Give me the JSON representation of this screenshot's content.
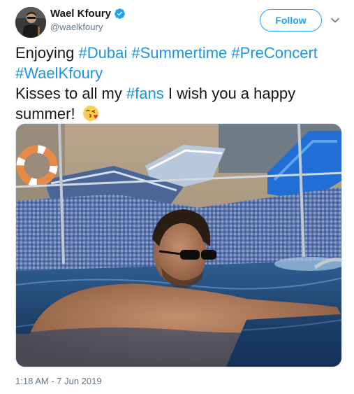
{
  "author": {
    "display_name": "Wael Kfoury",
    "handle": "@waelkfoury",
    "verified": true
  },
  "follow_button": {
    "label": "Follow"
  },
  "tweet": {
    "line1_prefix": "Enjoying ",
    "hashtag_dubai": "#Dubai",
    "hashtag_summertime": "#Summertime",
    "hashtag_preconcert": "#PreConcert",
    "hashtag_waelkfoury": "#WaelKfoury",
    "line3_prefix": "Kisses to all my ",
    "hashtag_fans": "#fans",
    "line3_suffix": " I wish you a happy",
    "line4": "summer!",
    "emoji": "face-blowing-a-kiss-icon"
  },
  "timestamp": "1:18 AM - 7 Jun 2019",
  "colors": {
    "link": "#1b95e0",
    "follow": "#1da1f2",
    "secondary_text": "#657786",
    "verified": "#1da1f2"
  },
  "icons": {
    "verified": "verified-badge-icon",
    "menu": "chevron-down-icon"
  }
}
